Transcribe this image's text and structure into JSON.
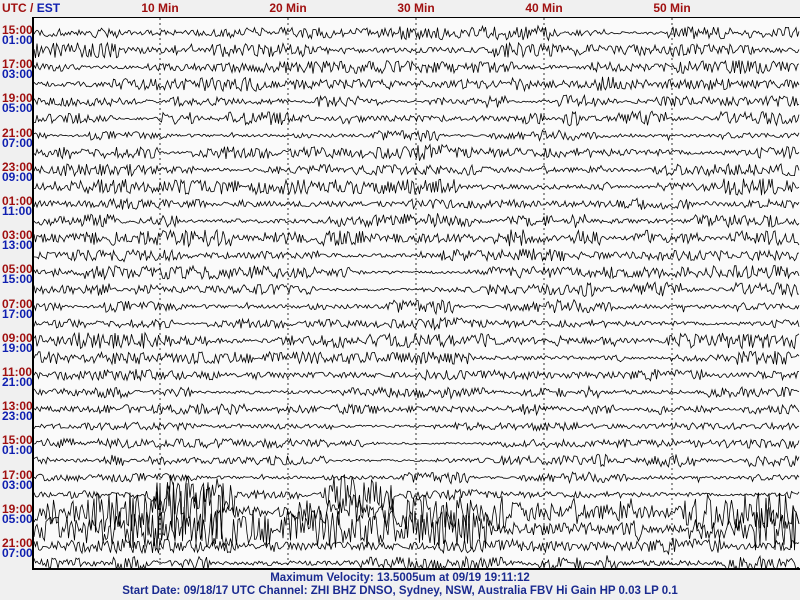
{
  "header": {
    "utc_label": "UTC",
    "sep": " / ",
    "est_label": "EST"
  },
  "chart_data": {
    "type": "line",
    "title": "Helicorder seismogram",
    "x_ticks": [
      {
        "min": 10,
        "label": "10 Min"
      },
      {
        "min": 20,
        "label": "20 Min"
      },
      {
        "min": 30,
        "label": "30 Min"
      },
      {
        "min": 40,
        "label": "40 Min"
      },
      {
        "min": 50,
        "label": "50 Min"
      }
    ],
    "xlim": [
      0,
      60
    ],
    "traces_per_label": 2,
    "utc_labels": [
      "15:00",
      "17:00",
      "19:00",
      "21:00",
      "23:00",
      "01:00",
      "03:00",
      "05:00",
      "07:00",
      "09:00",
      "11:00",
      "13:00",
      "15:00",
      "17:00",
      "19:00",
      "21:00"
    ],
    "est_labels": [
      "01:00",
      "03:00",
      "05:00",
      "07:00",
      "09:00",
      "11:00",
      "13:00",
      "15:00",
      "17:00",
      "19:00",
      "21:00",
      "23:00",
      "01:00",
      "03:00",
      "05:00",
      "07:00"
    ],
    "grid": "vertical dashed every 10 min",
    "trace_color": "#000000"
  },
  "footer": {
    "line1": "Maximum Velocity: 13.5005um at 09/19 19:11:12",
    "line2": "Start Date: 09/18/17 UTC Channel: ZHI  BHZ  DNSO, Sydney, NSW, Australia  FBV Hi Gain HP 0.03  LP 0.1"
  }
}
